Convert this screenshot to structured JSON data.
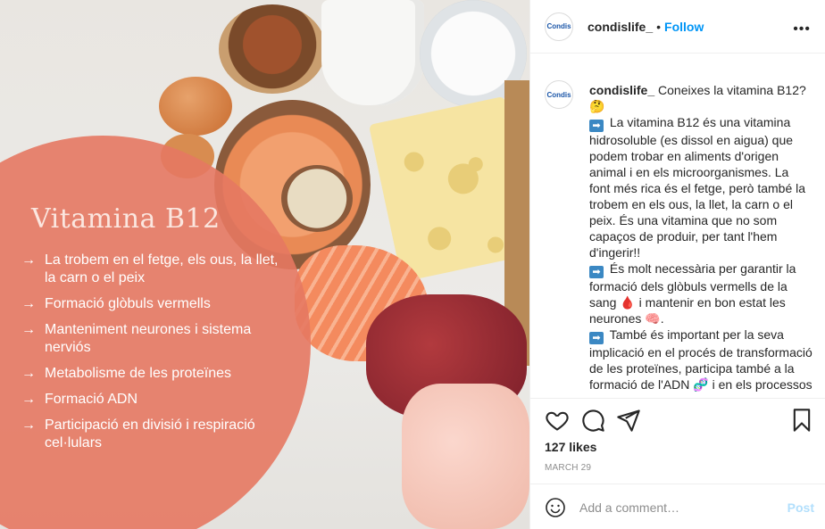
{
  "post_image": {
    "title": "Vitamina B12",
    "bullets": [
      "La trobem en el fetge, els ous, la llet, la carn o el peix",
      "Formació glòbuls vermells",
      "Manteniment neurones i sistema nerviós",
      "Metabolisme de les proteïnes",
      "Formació ADN",
      "Participació en divisió i respiració cel·lulars"
    ],
    "arrow_glyph": "→",
    "accent_color": "#e67862"
  },
  "header": {
    "avatar_text": "Condis",
    "username": "condislife_",
    "separator": "•",
    "follow_label": "Follow",
    "more_glyph": "•••"
  },
  "caption": {
    "username": "condislife_",
    "lines": [
      "Coneixes la vitamina B12? 🤔",
      "La vitamina B12 és una vitamina hidrosoluble (es dissol en aigua) que podem trobar en aliments d'origen animal i en els microorganismes. La font més rica és el fetge, però també la trobem en els ous, la llet, la carn o el peix. És una vitamina que no som capaços de produir, per tant l'hem d'ingerir!!",
      "És molt necessària per garantir la formació dels glòbuls vermells de la sang 🩸 i mantenir en bon estat les neurones 🧠.",
      "També és important per la seva implicació en el procés de transformació de les proteïnes, participa també a la formació de l'ADN 🧬 i en els processos de divisió"
    ],
    "arrow_icon": "➡"
  },
  "actions": {
    "like_icon": "heart-icon",
    "comment_icon": "comment-icon",
    "share_icon": "share-icon",
    "save_icon": "bookmark-icon",
    "likes_text": "127 likes",
    "date_text": "MARCH 29"
  },
  "comment": {
    "placeholder": "Add a comment…",
    "post_label": "Post",
    "emoji_icon": "smiley-icon"
  }
}
